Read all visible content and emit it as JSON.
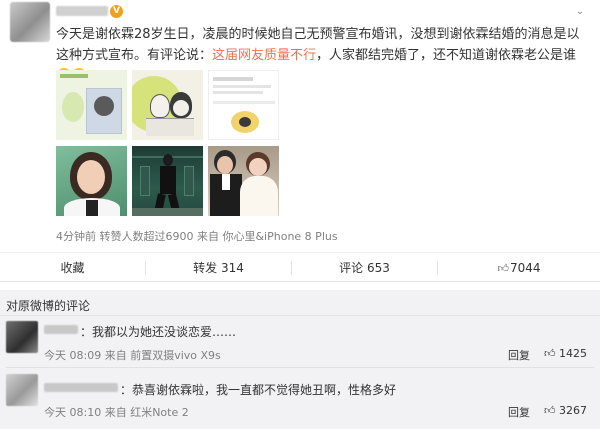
{
  "post": {
    "vip_badge": "V",
    "text": {
      "part1": "今天是谢依霖28岁生日，凌晨的时候她自己无预警宣布婚讯，没想到谢依霖结婚的消息是以这种方式宣布。有评论说：",
      "highlight": "这届网友质量不行",
      "part2": "，人家都结完婚了，还不知道谢依霖老公是谁"
    },
    "meta": "4分钟前 转赞人数超过6900 来自 你心里&iPhone 8 Plus"
  },
  "actions": {
    "favorite": "收藏",
    "repost": "转发 314",
    "comment": "评论 653",
    "like": "7044"
  },
  "comments": {
    "section_title": "对原微博的评论",
    "items": [
      {
        "text": "：我都以为她还没谈恋爱……",
        "time": "今天 08:09 来自 前置双摄vivo X9s",
        "reply": "回复",
        "likes": "1425"
      },
      {
        "text": "：恭喜谢依霖啦，我一直都不觉得她丑啊，性格多好",
        "time": "今天 08:10 来自 红米Note 2",
        "reply": "回复",
        "likes": "3267"
      }
    ]
  },
  "colors": {
    "highlight": "#eb7350",
    "vip": "#f0a020",
    "comment_bg": "#f2f2f5"
  },
  "icons": [
    "expand-icon",
    "vip-icon",
    "thumbs-up-icon",
    "like-icon"
  ]
}
